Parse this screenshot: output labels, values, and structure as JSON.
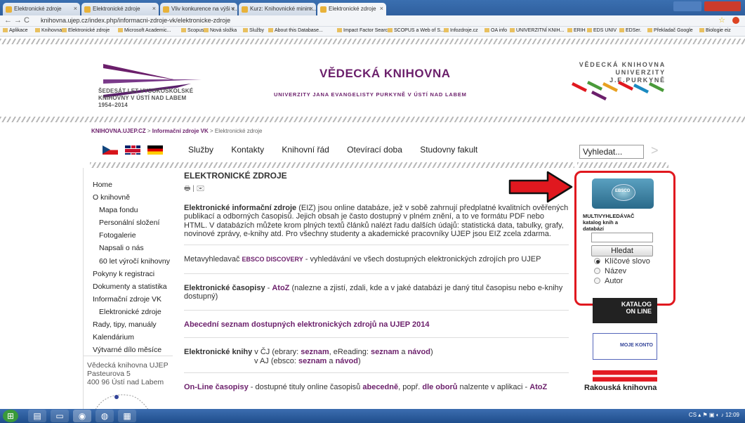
{
  "browser": {
    "tabs": [
      {
        "label": "Elektronické zdroje"
      },
      {
        "label": "Elektronické zdroje"
      },
      {
        "label": "Vliv konkurence na výši v..."
      },
      {
        "label": "Kurz: Knihovnické minim..."
      },
      {
        "label": "Elektronické zdroje"
      }
    ],
    "url": "knihovna.ujep.cz/index.php/informacni-zdroje-vk/elektronicke-zdroje",
    "bookmarks": [
      "Aplikace",
      "Knihovna",
      "Elektronické zdroje",
      "Microsoft Academic...",
      "Scopus",
      "Nová složka",
      "Služby",
      "About this Database...",
      "Impact Factor Searc...",
      "SCOPUS a Web of S...",
      "Infozdroje.cz",
      "OA info",
      "UNIVERZITNÍ KNIH...",
      "ERIH",
      "EDS UNIV",
      "EDSer.",
      "Překladač Google",
      "Biologie eiz"
    ]
  },
  "header": {
    "anniversary": "ŠEDESÁT LET VYSOKOŠKOLSKÉ\nKNIHOVNY V ÚSTÍ NAD LABEM\n1954–2014",
    "title": "VĚDECKÁ KNIHOVNA",
    "subtitle": "UNIVERZITY JANA EVANGELISTY PURKYNĚ V ÚSTÍ NAD LABEM",
    "right_title": "VĚDECKÁ KNIHOVNA\nUNIVERZITY J.E.PURKYNĚ"
  },
  "breadcrumb": {
    "home": "KNIHOVNA.UJEP.CZ",
    "sep1": " > ",
    "section": "Informační zdroje VK",
    "sep2": " > ",
    "current": "Elektronické zdroje"
  },
  "topnav": [
    "Služby",
    "Kontakty",
    "Knihovní řád",
    "Otevírací doba",
    "Studovny fakult"
  ],
  "search": {
    "value": "Vyhledat..."
  },
  "sidebar": {
    "items": [
      {
        "label": "Home",
        "sub": false
      },
      {
        "label": "O knihovně",
        "sub": false
      },
      {
        "label": "Mapa fondu",
        "sub": true
      },
      {
        "label": "Personální složení",
        "sub": true
      },
      {
        "label": "Fotogalerie",
        "sub": true
      },
      {
        "label": "Napsali o nás",
        "sub": true
      },
      {
        "label": "60 let výročí knihovny",
        "sub": true
      },
      {
        "label": "Pokyny k registraci",
        "sub": false
      },
      {
        "label": "Dokumenty a statistika",
        "sub": false
      },
      {
        "label": "Informační zdroje VK",
        "sub": false
      },
      {
        "label": "Elektronické zdroje",
        "sub": true
      },
      {
        "label": "Rady, tipy, manuály",
        "sub": false
      },
      {
        "label": "Kalendárium",
        "sub": false
      },
      {
        "label": "Výtvarné dílo měsíce",
        "sub": false
      }
    ],
    "address": "Vědecká knihovna UJEP\nPasteurova 5\n400 96 Ústí nad Labem"
  },
  "content": {
    "heading": "ELEKTRONICKÉ ZDROJE",
    "icons": "🖶 | ✉",
    "intro_bold": "Elektronické informační zdroje",
    "intro_rest": " (EIZ) jsou online databáze, jež v sobě zahrnují předplatné kvalitních ověřených publikací a odborných časopisů. Jejich obsah je často dostupný v plném znění, a to ve formátu PDF nebo HTML. V databázích můžete krom plných textů článků nalézt řadu dalších údajů: statistická data, tabulky, grafy, novinové zprávy, e-knihy atd. Pro všechny studenty a akademické pracovníky UJEP jsou EIZ zcela zdarma.",
    "meta_pre": "Metavyhledavač ",
    "meta_ebsco": "EBSCO DISCOVERY",
    "meta_post": " - vyhledávání ve všech dostupných elektronických zdrojích pro UJEP",
    "ejournals_bold": "Elektronické časopisy",
    "ejournals_dash": " - ",
    "ejournals_atoz": "AtoZ",
    "ejournals_rest": "  (nalezne a zjistí, zdali, kde a v jaké databázi je daný titul časopisu nebo e-knihy dostupný)",
    "alphalist": "Abecední seznam dostupných elektronických zdrojů na UJEP 2014",
    "ebooks_bold": "Elektronické knihy",
    "ebooks_cz_pre": " v ČJ (ebrary: ",
    "ebooks_seznam1": "seznam",
    "ebooks_cz_mid": ", eReading: ",
    "ebooks_seznam2": "seznam",
    "ebooks_a1": " a ",
    "ebooks_navod1": "návod",
    "ebooks_close1": ")",
    "ebooks_aj_pre": "v AJ (ebsco: ",
    "ebooks_seznam3": "seznam",
    "ebooks_a2": " a ",
    "ebooks_navod2": "návod",
    "ebooks_close2": ")",
    "online_bold": "On-Line časopisy",
    "online_pre": " - dostupné tituly online časopisů ",
    "online_abc": "abecedně",
    "online_mid": ", popř. ",
    "online_obor": "dle oborů",
    "online_post": " nalzente v aplikaci - ",
    "online_atoz": "AtoZ"
  },
  "multisearch": {
    "logo": "EBSCO",
    "title": "MULTIVYHLEDÁVAČ\nkatalog knih a\ndatabází",
    "input_value": "",
    "button": "Hledat",
    "options": [
      {
        "label": "Klíčové slovo",
        "selected": true
      },
      {
        "label": "Název",
        "selected": false
      },
      {
        "label": "Autor",
        "selected": false
      }
    ]
  },
  "banners": {
    "katalog": "KATALOG\nON LINE",
    "konto": "MOJE KONTO",
    "rakouska": "Rakouská knihovna"
  },
  "taskbar": {
    "lang": "CS",
    "time": "12:09"
  },
  "colors": {
    "accent": "#6b1f6b",
    "highlight": "#e0181f"
  }
}
